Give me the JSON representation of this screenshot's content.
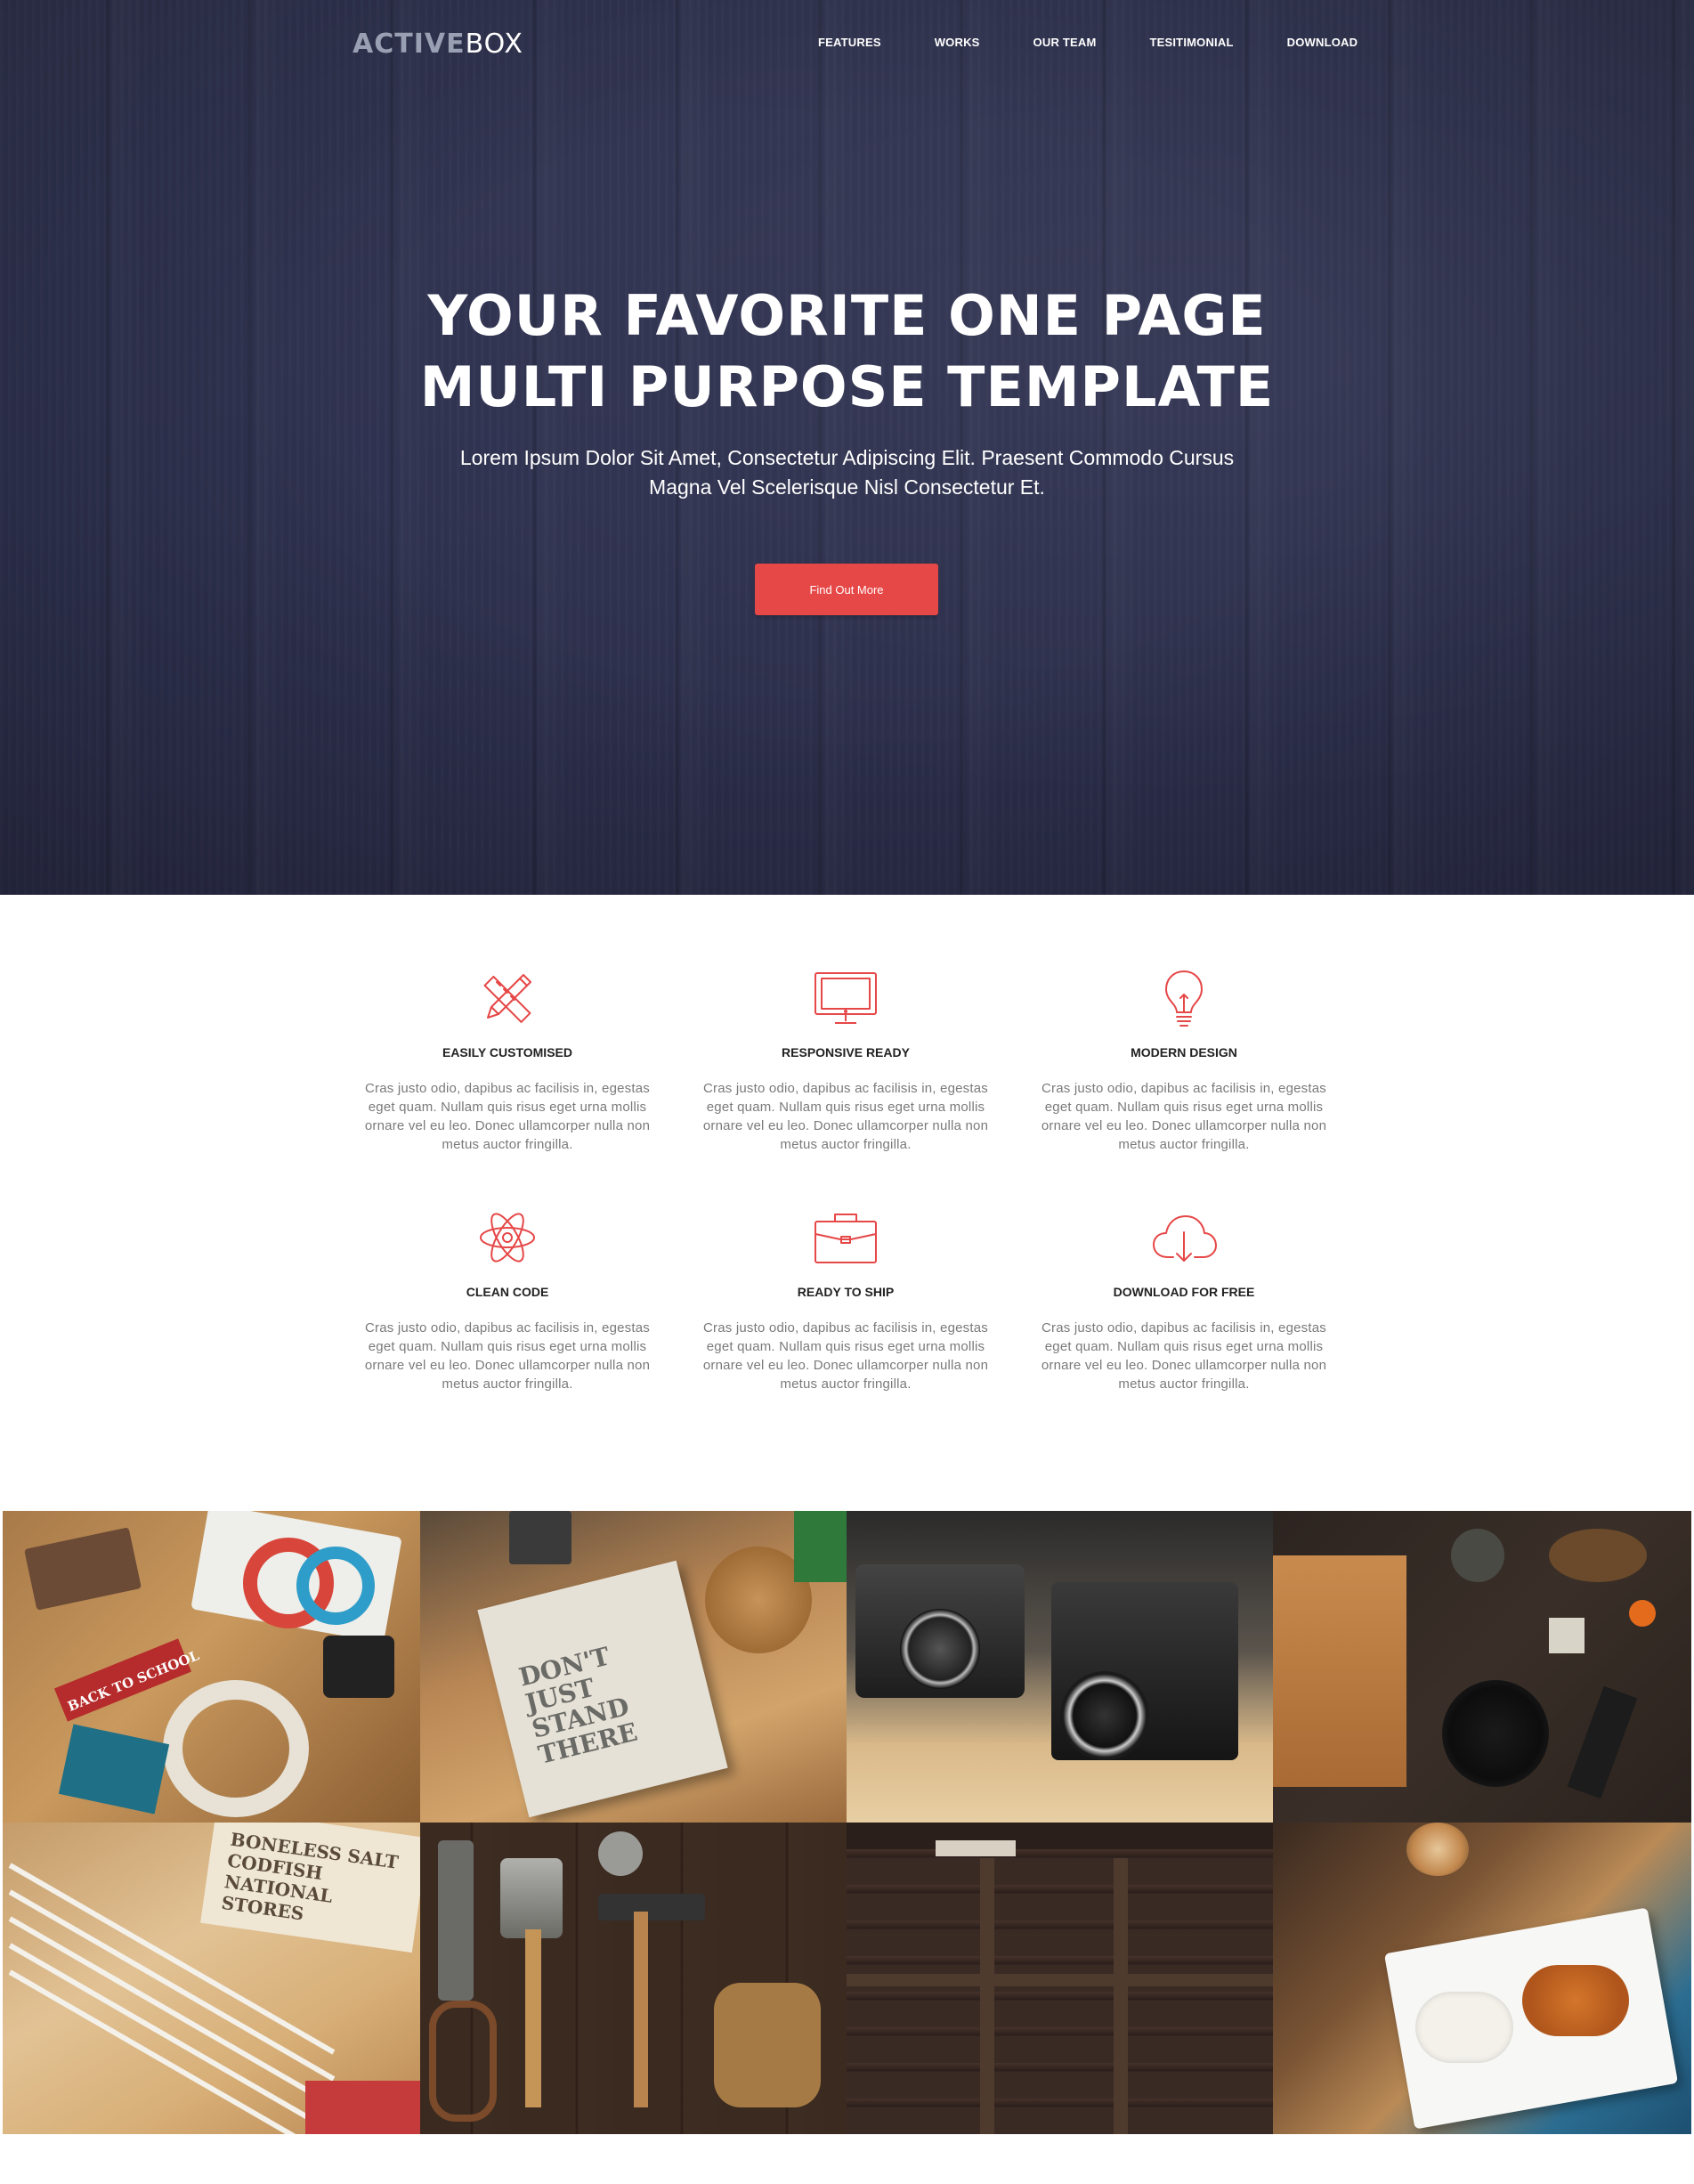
{
  "brand": {
    "logo_part1": "ACTIVE",
    "logo_part2": "BOX"
  },
  "nav": {
    "items": [
      "FEATURES",
      "WORKS",
      "OUR TEAM",
      "TESITIMONIAL",
      "DOWNLOAD"
    ]
  },
  "hero": {
    "title_line1": "YOUR FAVORITE ONE PAGE",
    "title_line2": "MULTI PURPOSE TEMPLATE",
    "subtitle_line1": "Lorem Ipsum Dolor Sit Amet, Consectetur Adipiscing Elit. Praesent Commodo Cursus",
    "subtitle_line2": "Magna Vel Scelerisque Nisl Consectetur Et.",
    "cta_label": "Find Out More"
  },
  "features": {
    "items": [
      {
        "icon": "pencil-ruler-icon",
        "title": "EASILY CUSTOMISED",
        "text": "Cras justo odio, dapibus ac facilisis in, egestas eget quam. Nullam quis risus eget urna mollis ornare vel eu leo. Donec ullamcorper nulla non metus auctor fringilla."
      },
      {
        "icon": "monitor-icon",
        "title": "RESPONSIVE READY",
        "text": "Cras justo odio, dapibus ac facilisis in, egestas eget quam. Nullam quis risus eget urna mollis ornare vel eu leo. Donec ullamcorper nulla non metus auctor fringilla."
      },
      {
        "icon": "lightbulb-icon",
        "title": "MODERN DESIGN",
        "text": "Cras justo odio, dapibus ac facilisis in, egestas eget quam. Nullam quis risus eget urna mollis ornare vel eu leo. Donec ullamcorper nulla non metus auctor fringilla."
      },
      {
        "icon": "atom-icon",
        "title": "CLEAN CODE",
        "text": "Cras justo odio, dapibus ac facilisis in, egestas eget quam. Nullam quis risus eget urna mollis ornare vel eu leo. Donec ullamcorper nulla non metus auctor fringilla."
      },
      {
        "icon": "briefcase-icon",
        "title": "READY TO SHIP",
        "text": "Cras justo odio, dapibus ac facilisis in, egestas eget quam. Nullam quis risus eget urna mollis ornare vel eu leo. Donec ullamcorper nulla non metus auctor fringilla."
      },
      {
        "icon": "cloud-download-icon",
        "title": "DOWNLOAD FOR FREE",
        "text": "Cras justo odio, dapibus ac facilisis in, egestas eget quam. Nullam quis risus eget urna mollis ornare vel eu leo. Donec ullamcorper nulla non metus auctor fringilla."
      }
    ]
  },
  "gallery": {
    "tiles": [
      {
        "subject": "back-to-school-flatlay",
        "label": "BACK TO SCHOOL"
      },
      {
        "subject": "notebook-coasters",
        "label": "DON'T JUST STAND THERE"
      },
      {
        "subject": "vintage-cameras",
        "label": ""
      },
      {
        "subject": "kitchen-board-spices",
        "label": ""
      },
      {
        "subject": "pencils-sign",
        "label": "BONELESS SALT CODFISH NATIONAL STORES"
      },
      {
        "subject": "tools-on-wood",
        "label": ""
      },
      {
        "subject": "letterpress-type",
        "label": ""
      },
      {
        "subject": "dessert-plate",
        "label": ""
      }
    ]
  },
  "colors": {
    "hero_bg": "#2f3250",
    "accent": "#e64747",
    "feature_title": "#222222",
    "feature_text": "#7a7a7a"
  }
}
